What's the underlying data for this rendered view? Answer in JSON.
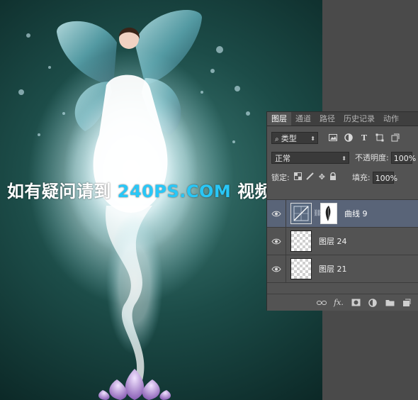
{
  "colors": {
    "background": "#0d2a28",
    "glow": "#ffffff",
    "panel": "#535353",
    "selected_row": "#596478",
    "watermark_brand": "#28c7f7"
  },
  "watermark": {
    "prefix": "如有疑问请到 ",
    "brand": "240PS.COM",
    "suffix": " 视频栏目观看视频教程"
  },
  "layers_panel": {
    "tabs": [
      "图层",
      "通道",
      "路径",
      "历史记录",
      "动作"
    ],
    "active_tab": "图层",
    "filter": {
      "kind_label": "类型",
      "icons": [
        "image-filter-icon",
        "adjustment-filter-icon",
        "type-filter-icon",
        "shape-filter-icon",
        "smartobject-filter-icon"
      ]
    },
    "blend_mode": "正常",
    "opacity_label": "不透明度:",
    "opacity_value": "100%",
    "lock_label": "锁定:",
    "fill_label": "填充:",
    "fill_value": "100%",
    "layers": [
      {
        "name": "曲线 9",
        "type": "adjustment",
        "selected": true,
        "visible": true
      },
      {
        "name": "图层 24",
        "type": "pixel",
        "selected": false,
        "visible": true
      },
      {
        "name": "图层 21",
        "type": "pixel",
        "selected": false,
        "visible": true
      }
    ],
    "footer_icons": [
      "link-icon",
      "fx-icon",
      "mask-icon",
      "adjustment-icon",
      "group-folder-icon",
      "new-layer-icon"
    ]
  }
}
